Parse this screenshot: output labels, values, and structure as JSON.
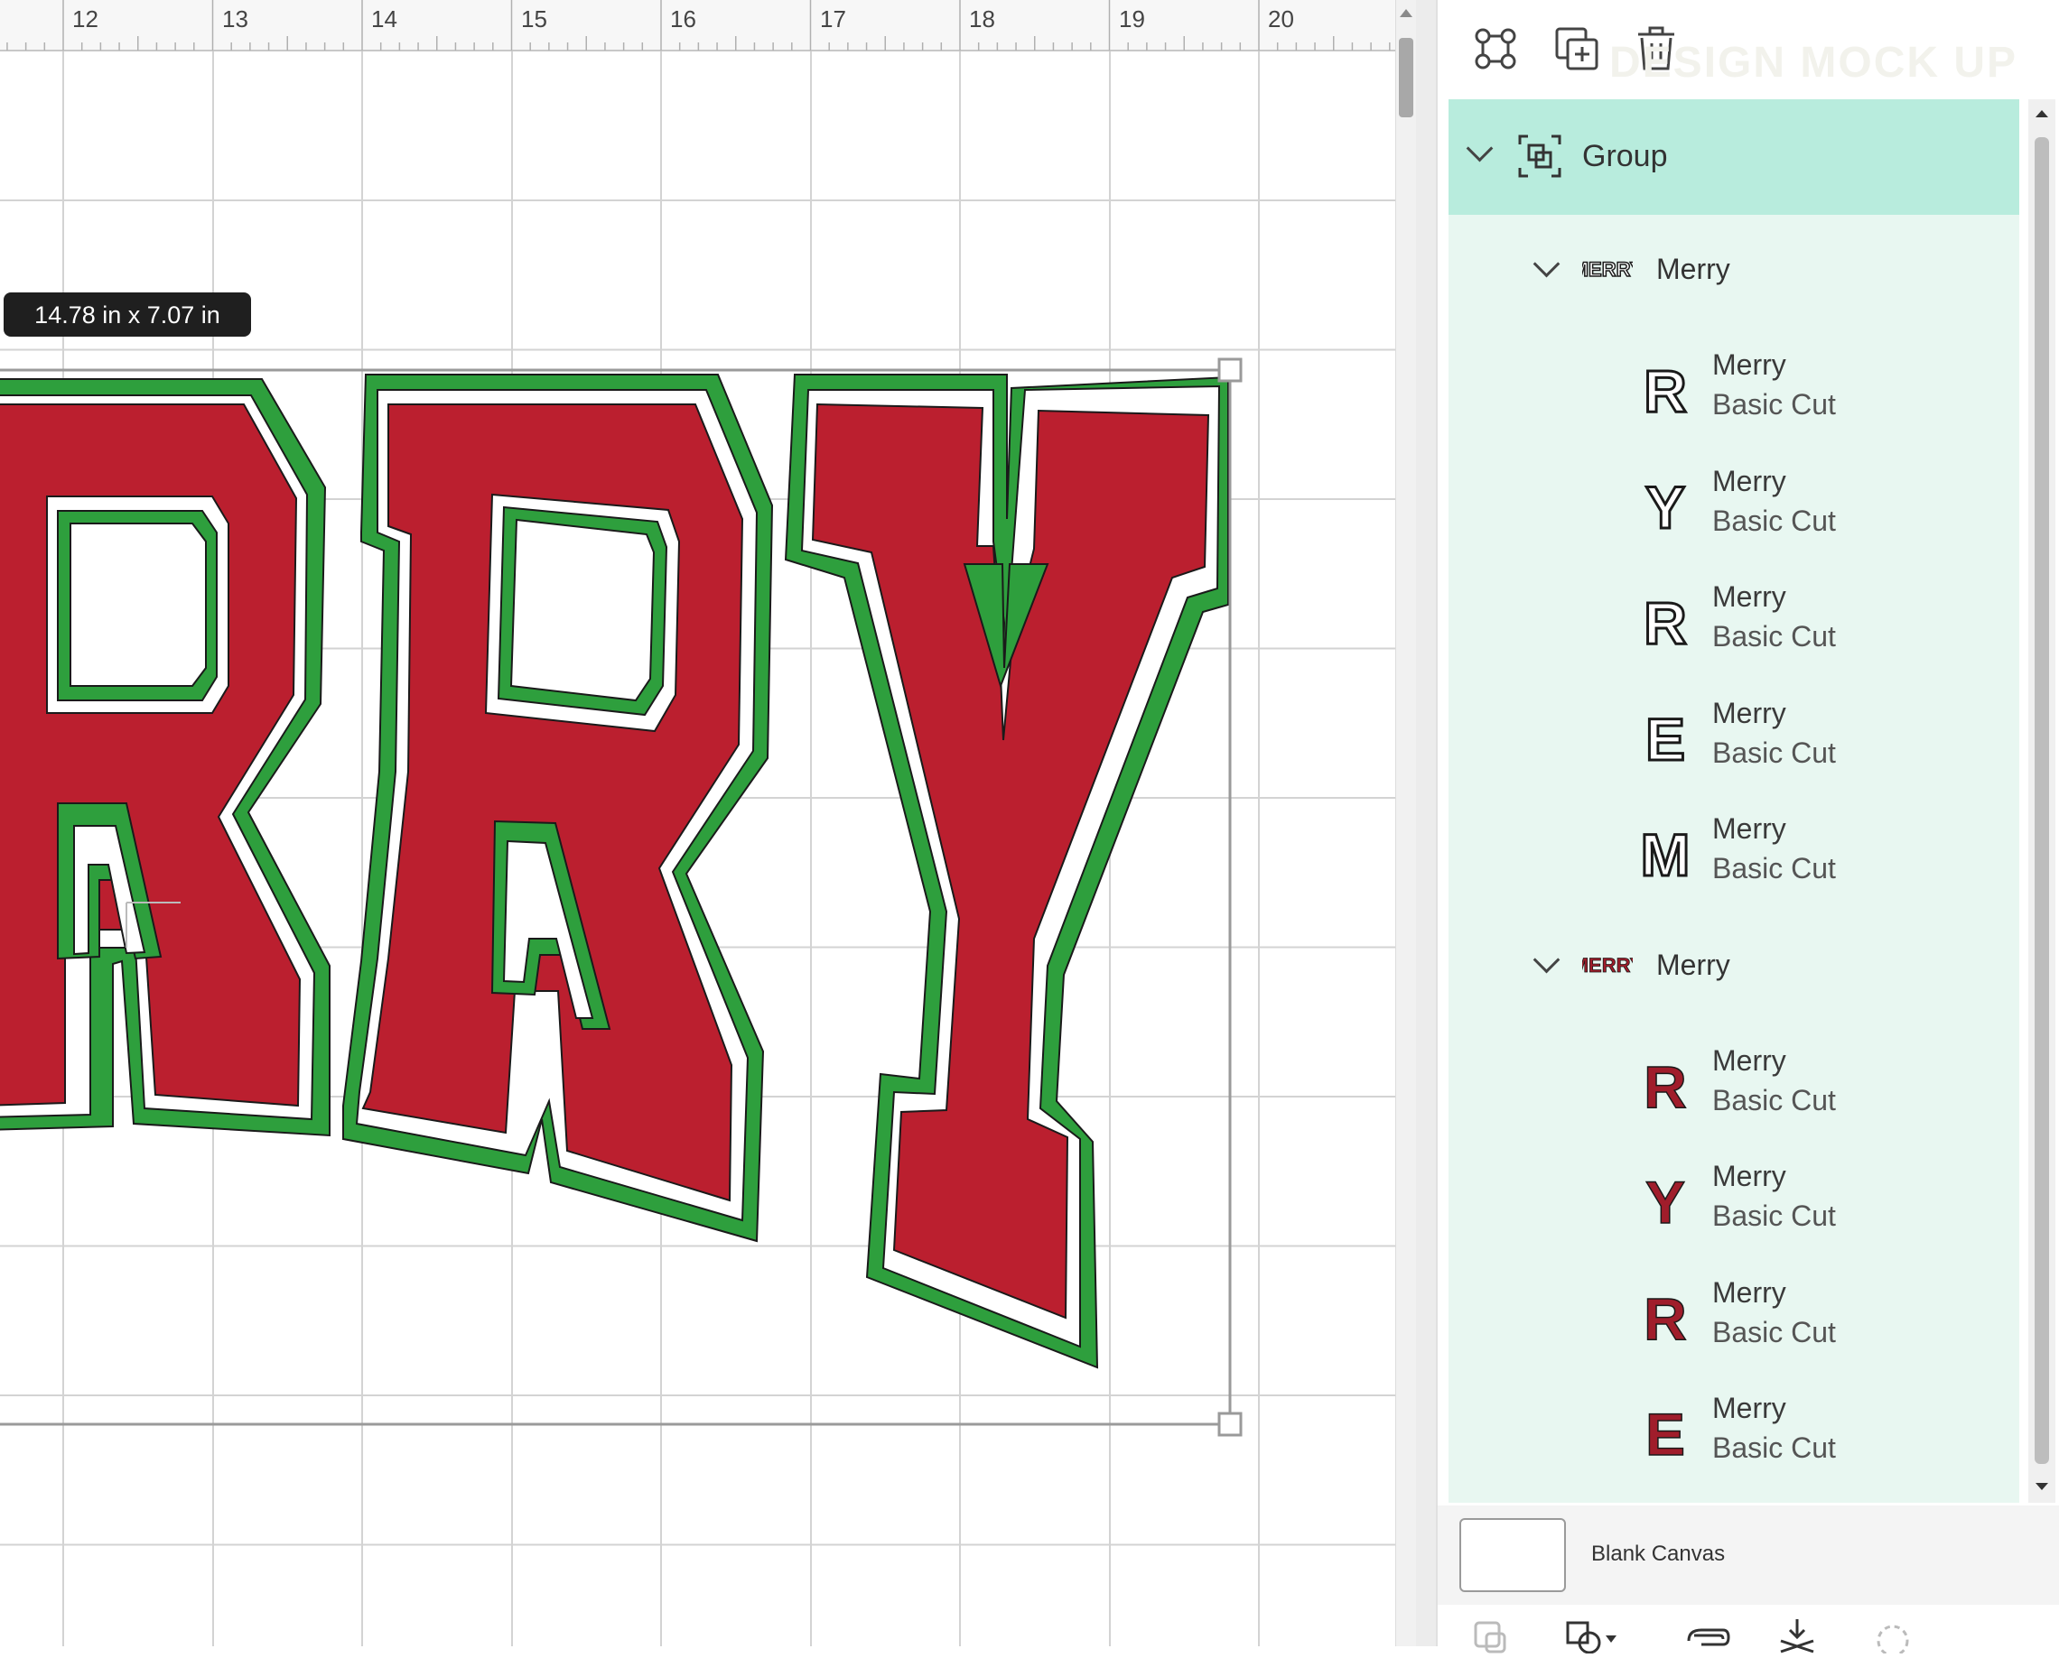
{
  "canvas": {
    "ruler_labels": [
      "12",
      "13",
      "14",
      "15",
      "16",
      "17",
      "18",
      "19",
      "20"
    ],
    "dimension_label": "14.78  in x 7.07  in",
    "artwork_text": "RRY",
    "colors": {
      "letter_fill": "#bb1f2f",
      "letter_outline": "#2e9f3d",
      "grid_line": "#d3d3d3",
      "ruler_bg": "#f7f7f7"
    }
  },
  "toolbar": {
    "icons": [
      "ungroup-icon",
      "duplicate-icon",
      "delete-icon"
    ]
  },
  "watermark": "DESIGN MOCK UP",
  "layers": {
    "group_label": "Group",
    "subgroups": [
      {
        "label": "Merry",
        "style": "outline",
        "items": [
          {
            "letter": "R",
            "name": "Merry",
            "operation": "Basic Cut"
          },
          {
            "letter": "Y",
            "name": "Merry",
            "operation": "Basic Cut"
          },
          {
            "letter": "R",
            "name": "Merry",
            "operation": "Basic Cut"
          },
          {
            "letter": "E",
            "name": "Merry",
            "operation": "Basic Cut"
          },
          {
            "letter": "M",
            "name": "Merry",
            "operation": "Basic Cut"
          }
        ]
      },
      {
        "label": "Merry",
        "style": "red",
        "items": [
          {
            "letter": "R",
            "name": "Merry",
            "operation": "Basic Cut"
          },
          {
            "letter": "Y",
            "name": "Merry",
            "operation": "Basic Cut"
          },
          {
            "letter": "R",
            "name": "Merry",
            "operation": "Basic Cut"
          },
          {
            "letter": "E",
            "name": "Merry",
            "operation": "Basic Cut"
          }
        ]
      }
    ]
  },
  "blank_canvas_label": "Blank Canvas",
  "bottom_toolbar": {
    "icons": [
      "group-icon",
      "combine-icon",
      "attach-icon",
      "flatten-icon",
      "contour-icon"
    ]
  }
}
